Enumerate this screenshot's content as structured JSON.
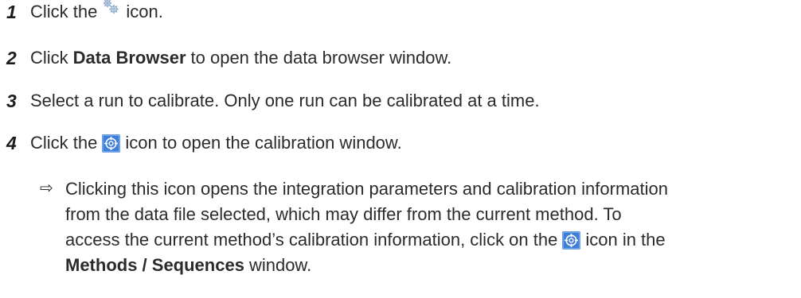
{
  "steps": [
    {
      "number": "1",
      "before": "Click the",
      "icon": "gears-icon",
      "after": "icon."
    },
    {
      "number": "2",
      "before": "Click",
      "bold": "Data Browser",
      "after": "to open the data browser window."
    },
    {
      "number": "3",
      "text": "Select a run to calibrate. Only one run can be calibrated at a time."
    },
    {
      "number": "4",
      "before": "Click the",
      "icon": "calibration-icon",
      "after": "icon to open the calibration window."
    }
  ],
  "result": {
    "arrow": "⇨",
    "line1": "Clicking this icon opens the integration parameters and calibration information",
    "line2": "from the data file selected, which may differ from the current method. To",
    "line3_before": "access the current method’s calibration information, click on the",
    "line3_icon": "calibration-icon",
    "line3_after": "icon in the",
    "line4_bold": "Methods / Sequences",
    "line4_after": "window."
  },
  "colors": {
    "text": "#2b2b2b",
    "icon_blue": "#3f7fd9",
    "icon_gears": "#8aa8cc"
  }
}
